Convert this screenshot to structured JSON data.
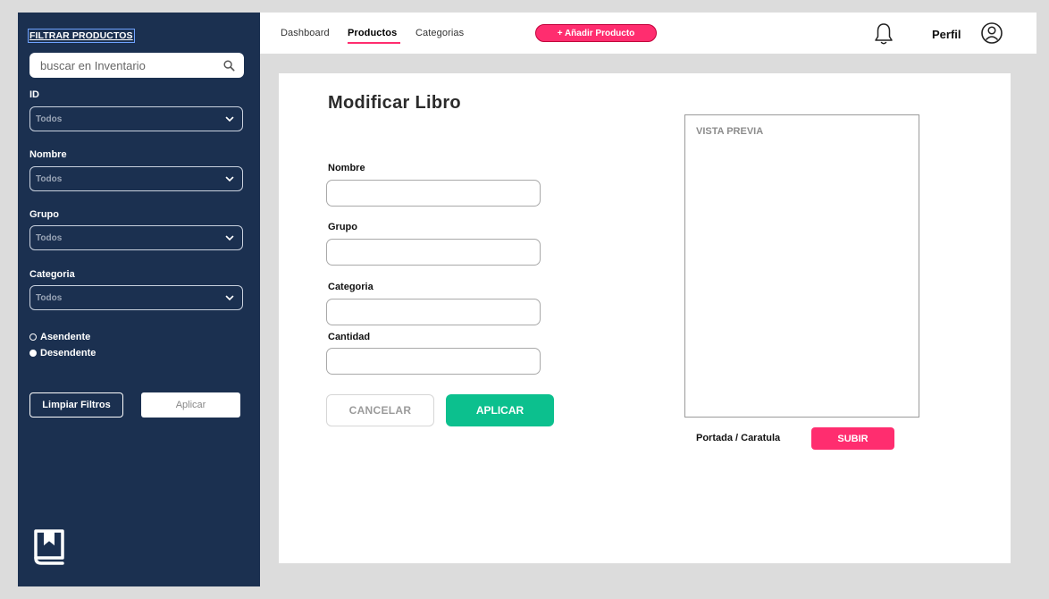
{
  "sidebar": {
    "title": "FILTRAR PRODUCTOS",
    "search_placeholder": "buscar en Inventario",
    "filters": [
      {
        "label": "ID",
        "value": "Todos"
      },
      {
        "label": "Nombre",
        "value": "Todos"
      },
      {
        "label": "Grupo",
        "value": "Todos"
      },
      {
        "label": "Categoria",
        "value": "Todos"
      }
    ],
    "sort_options": [
      {
        "label": "Asendente",
        "selected": false
      },
      {
        "label": "Desendente",
        "selected": true
      }
    ],
    "clear_label": "Limpiar Filtros",
    "apply_label": "Aplicar"
  },
  "topnav": {
    "links": [
      "Dashboard",
      "Productos",
      "Categorias"
    ],
    "active_link": "Productos",
    "add_label": "+ Añadir Producto",
    "profile_label": "Perfil"
  },
  "form": {
    "title": "Modificar Libro",
    "fields": [
      {
        "label": "Nombre",
        "value": ""
      },
      {
        "label": "Grupo",
        "value": ""
      },
      {
        "label": "Categoria",
        "value": ""
      },
      {
        "label": "Cantidad",
        "value": ""
      }
    ],
    "cancel_label": "CANCELAR",
    "apply_label": "APLICAR",
    "preview_label": "VISTA PREVIA",
    "cover_label": "Portada / Caratula",
    "upload_label": "SUBIR"
  },
  "colors": {
    "sidebar_bg": "#1b3050",
    "accent_pink": "#ff2d6f",
    "accent_green": "#0cc08e"
  }
}
